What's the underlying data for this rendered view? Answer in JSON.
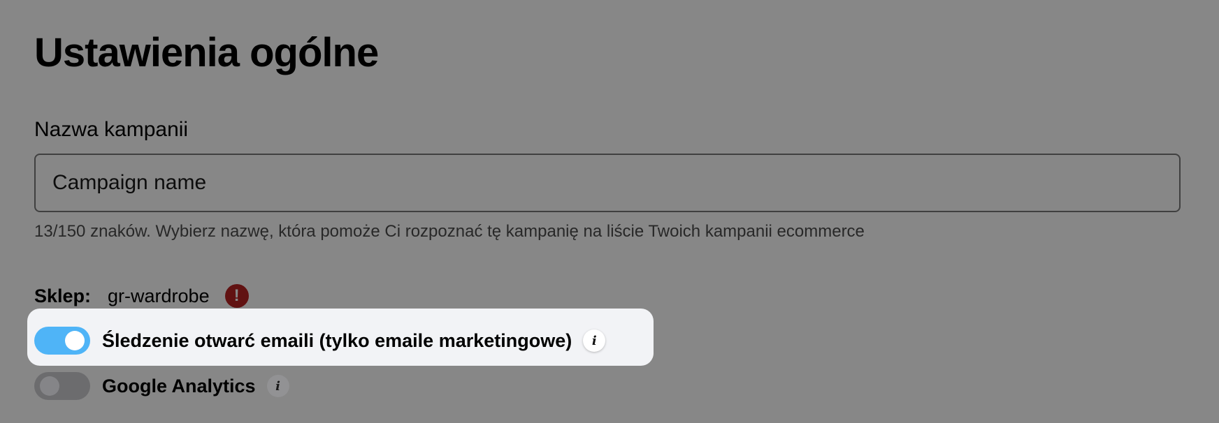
{
  "header": {
    "title": "Ustawienia ogólne"
  },
  "campaign_name": {
    "label": "Nazwa kampanii",
    "value": "Campaign name",
    "helper": "13/150 znaków. Wybierz nazwę, która pomoże Ci rozpoznać tę kampanię na liście Twoich kampanii ecommerce"
  },
  "shop": {
    "label": "Sklep:",
    "value": "gr-wardrobe",
    "alert_icon": "alert-circle-icon",
    "alert_glyph": "!",
    "alert_color": "#b82323"
  },
  "tracking": {
    "email_opens": {
      "label": "Śledzenie otwarć emaili (tylko emaile marketingowe)",
      "enabled": true,
      "info_glyph": "i"
    },
    "google_analytics": {
      "label": "Google Analytics",
      "enabled": false,
      "info_glyph": "i"
    }
  },
  "colors": {
    "toggle_on": "#4fb4f7",
    "highlight_background": "#f2f3f6",
    "alert": "#b82323"
  }
}
